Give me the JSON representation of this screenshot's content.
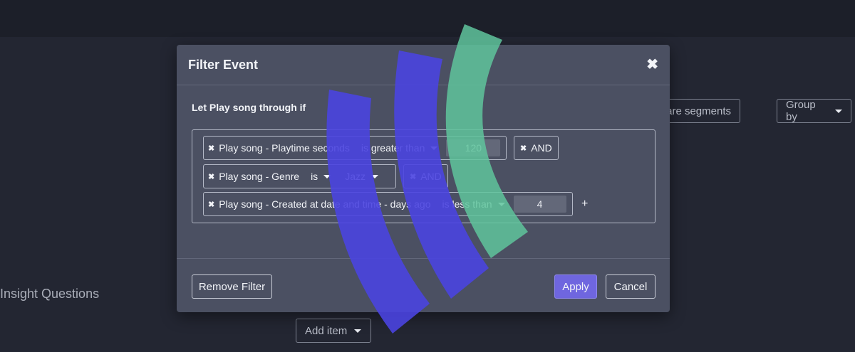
{
  "background": {
    "compare_segments_label": "are segments",
    "group_by_label": "Group by",
    "insight_heading": "Insight Questions",
    "add_item_label": "Add item"
  },
  "modal": {
    "title": "Filter Event",
    "close_glyph": "✖",
    "intro": "Let Play song through if",
    "remove_glyph": "✖",
    "rules": [
      {
        "property": "Play song - Playtime seconds",
        "operator": "is greater than",
        "value": "120",
        "connector": "AND"
      },
      {
        "property": "Play song - Genre",
        "operator": "is",
        "value": "Jazz",
        "connector": "AND"
      },
      {
        "property": "Play song - Created at date and time - days ago",
        "operator": "is less than",
        "value": "4",
        "add_label": "+"
      }
    ],
    "footer": {
      "remove_filter_label": "Remove Filter",
      "apply_label": "Apply",
      "cancel_label": "Cancel"
    }
  },
  "colors": {
    "backdrop": "#232632",
    "modal_bg": "#4b5062",
    "apply_accent": "#6f66df",
    "arc_blue": "#4a44e0",
    "arc_green": "#5fc49c"
  }
}
